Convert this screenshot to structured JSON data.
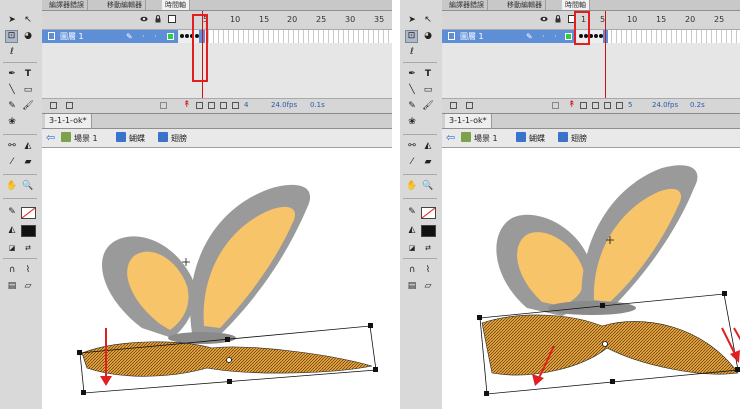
{
  "left": {
    "panel_tabs": [
      "編譯器錯誤",
      "移動編輯器",
      "時間軸"
    ],
    "active_tab": 2,
    "ruler_numbers": [
      "5",
      "10",
      "15",
      "20",
      "25",
      "30",
      "35"
    ],
    "layer_name": "圖層 1",
    "footer": {
      "frame": "4",
      "fps": "24.0fps",
      "time": "0.1s"
    },
    "document_tab": "3-1-1-ok*",
    "breadcrumbs": [
      "場景 1",
      "蝴蝶",
      "翅膀"
    ]
  },
  "right": {
    "panel_tabs": [
      "編譯器錯誤",
      "移動編輯器",
      "時間軸"
    ],
    "active_tab": 2,
    "ruler_numbers": [
      "1",
      "5",
      "10",
      "15",
      "20",
      "25"
    ],
    "layer_name": "圖層 1",
    "footer": {
      "frame": "5",
      "fps": "24.0fps",
      "time": "0.2s"
    },
    "document_tab": "3-1-1-ok*",
    "breadcrumbs": [
      "場景 1",
      "蝴蝶",
      "翅膀"
    ]
  },
  "colors": {
    "highlight": "#e02020",
    "layer_selected": "#5e8fd6",
    "wing_orange": "#f7c46a",
    "wing_dark": "#9a9a9a"
  },
  "icons": [
    "arrow-tool-icon",
    "subselect-tool-icon",
    "free-transform-icon",
    "lasso-icon",
    "pen-tool-icon",
    "text-tool-icon",
    "line-tool-icon",
    "rectangle-tool-icon",
    "pencil-icon",
    "brush-icon",
    "paint-bucket-icon",
    "eyedropper-icon",
    "eraser-icon",
    "hand-icon",
    "zoom-icon",
    "stroke-color-icon",
    "fill-color-icon",
    "eye-icon",
    "lock-icon",
    "outline-icon",
    "back-arrow-icon",
    "scene-icon",
    "symbol-icon"
  ]
}
